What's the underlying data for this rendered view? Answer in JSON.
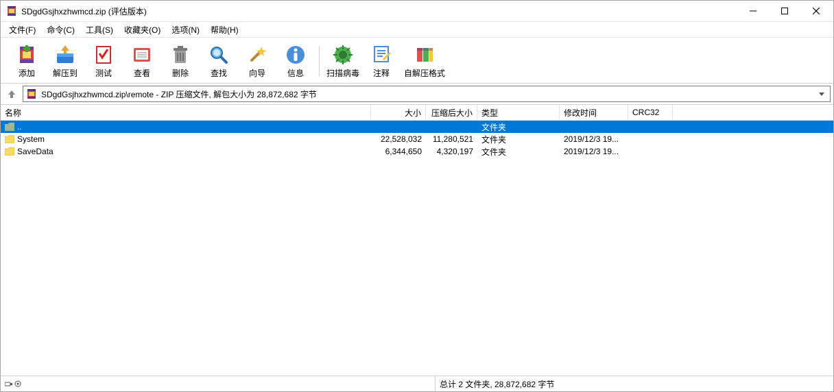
{
  "window": {
    "title": "SDgdGsjhxzhwmcd.zip (评估版本)"
  },
  "menu": {
    "file": "文件(F)",
    "cmd": "命令(C)",
    "tool": "工具(S)",
    "fav": "收藏夹(O)",
    "opt": "选项(N)",
    "help": "帮助(H)"
  },
  "toolbar": {
    "add": "添加",
    "extract": "解压到",
    "test": "测试",
    "view": "查看",
    "delete": "删除",
    "find": "查找",
    "wizard": "向导",
    "info": "信息",
    "scan": "扫描病毒",
    "comment": "注释",
    "sfx": "自解压格式"
  },
  "address": {
    "text": "SDgdGsjhxzhwmcd.zip\\remote - ZIP 压缩文件, 解包大小为 28,872,682 字节"
  },
  "columns": {
    "name": "名称",
    "size": "大小",
    "packed": "压缩后大小",
    "type": "类型",
    "modified": "修改时间",
    "crc": "CRC32"
  },
  "rows": {
    "up": {
      "name": "..",
      "type": "文件夹"
    },
    "r1": {
      "name": "System",
      "size": "22,528,032",
      "packed": "11,280,521",
      "type": "文件夹",
      "modified": "2019/12/3 19..."
    },
    "r2": {
      "name": "SaveData",
      "size": "6,344,650",
      "packed": "4,320,197",
      "type": "文件夹",
      "modified": "2019/12/3 19..."
    }
  },
  "status": {
    "summary": "总计 2 文件夹, 28,872,682 字节"
  }
}
